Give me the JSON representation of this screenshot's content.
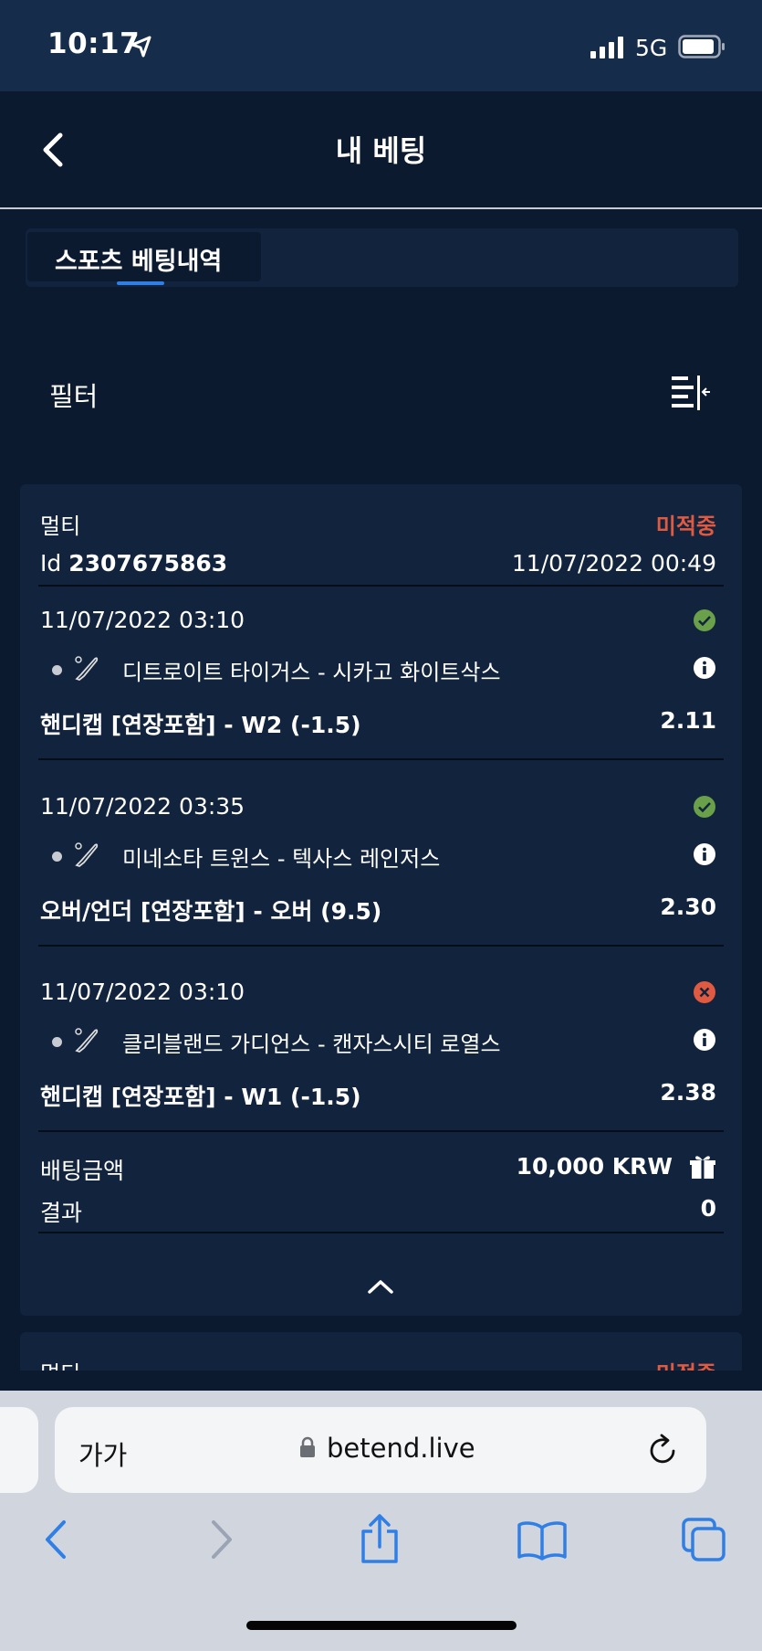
{
  "status_bar": {
    "time": "10:17",
    "network": "5G"
  },
  "header": {
    "title": "내 베팅"
  },
  "tabs": [
    {
      "label": "스포츠 베팅내역",
      "active": true
    }
  ],
  "filter": {
    "label": "필터"
  },
  "bet": {
    "type": "멀티",
    "status": "미적중",
    "id_prefix": "Id",
    "id": "2307675863",
    "placed_at": "11/07/2022 00:49",
    "selections": [
      {
        "time": "11/07/2022 03:10",
        "match": "디트로이트 타이거스 - 시카고 화이트삭스",
        "market": "핸디캡 [연장포함] - W2 (-1.5)",
        "odds": "2.11",
        "result": "won"
      },
      {
        "time": "11/07/2022 03:35",
        "match": "미네소타 트윈스 - 텍사스 레인저스",
        "market": "오버/언더 [연장포함] - 오버 (9.5)",
        "odds": "2.30",
        "result": "won"
      },
      {
        "time": "11/07/2022 03:10",
        "match": "클리블랜드 가디언스 - 캔자스시티 로열스",
        "market": "핸디캡 [연장포함] - W1 (-1.5)",
        "odds": "2.38",
        "result": "lost"
      }
    ],
    "stake_label": "배팅금액",
    "stake": "10,000 KRW",
    "result_label": "결과",
    "result": "0"
  },
  "next_bet": {
    "type": "멀티",
    "status": "미적중"
  },
  "browser": {
    "text_size_label": "가가",
    "url": "betend.live"
  },
  "colors": {
    "lost": "#e05a41",
    "won": "#6aa04a",
    "accent": "#2f7fe6",
    "bg": "#0b1a2e",
    "card": "#11233d"
  },
  "icons": {
    "status_bar": [
      "location-arrow-icon",
      "signal-icon",
      "battery-icon"
    ],
    "header": [
      "back-chevron-icon"
    ],
    "filter": "filter-collapse-icon",
    "selection": [
      "baseball-icon",
      "info-icon",
      "check-circle-icon",
      "x-circle-icon"
    ],
    "stake": "gift-icon",
    "card": "chevron-up-icon",
    "browser": [
      "lock-icon",
      "reload-icon",
      "back-icon",
      "forward-icon",
      "share-icon",
      "bookmarks-icon",
      "tabs-icon"
    ]
  }
}
